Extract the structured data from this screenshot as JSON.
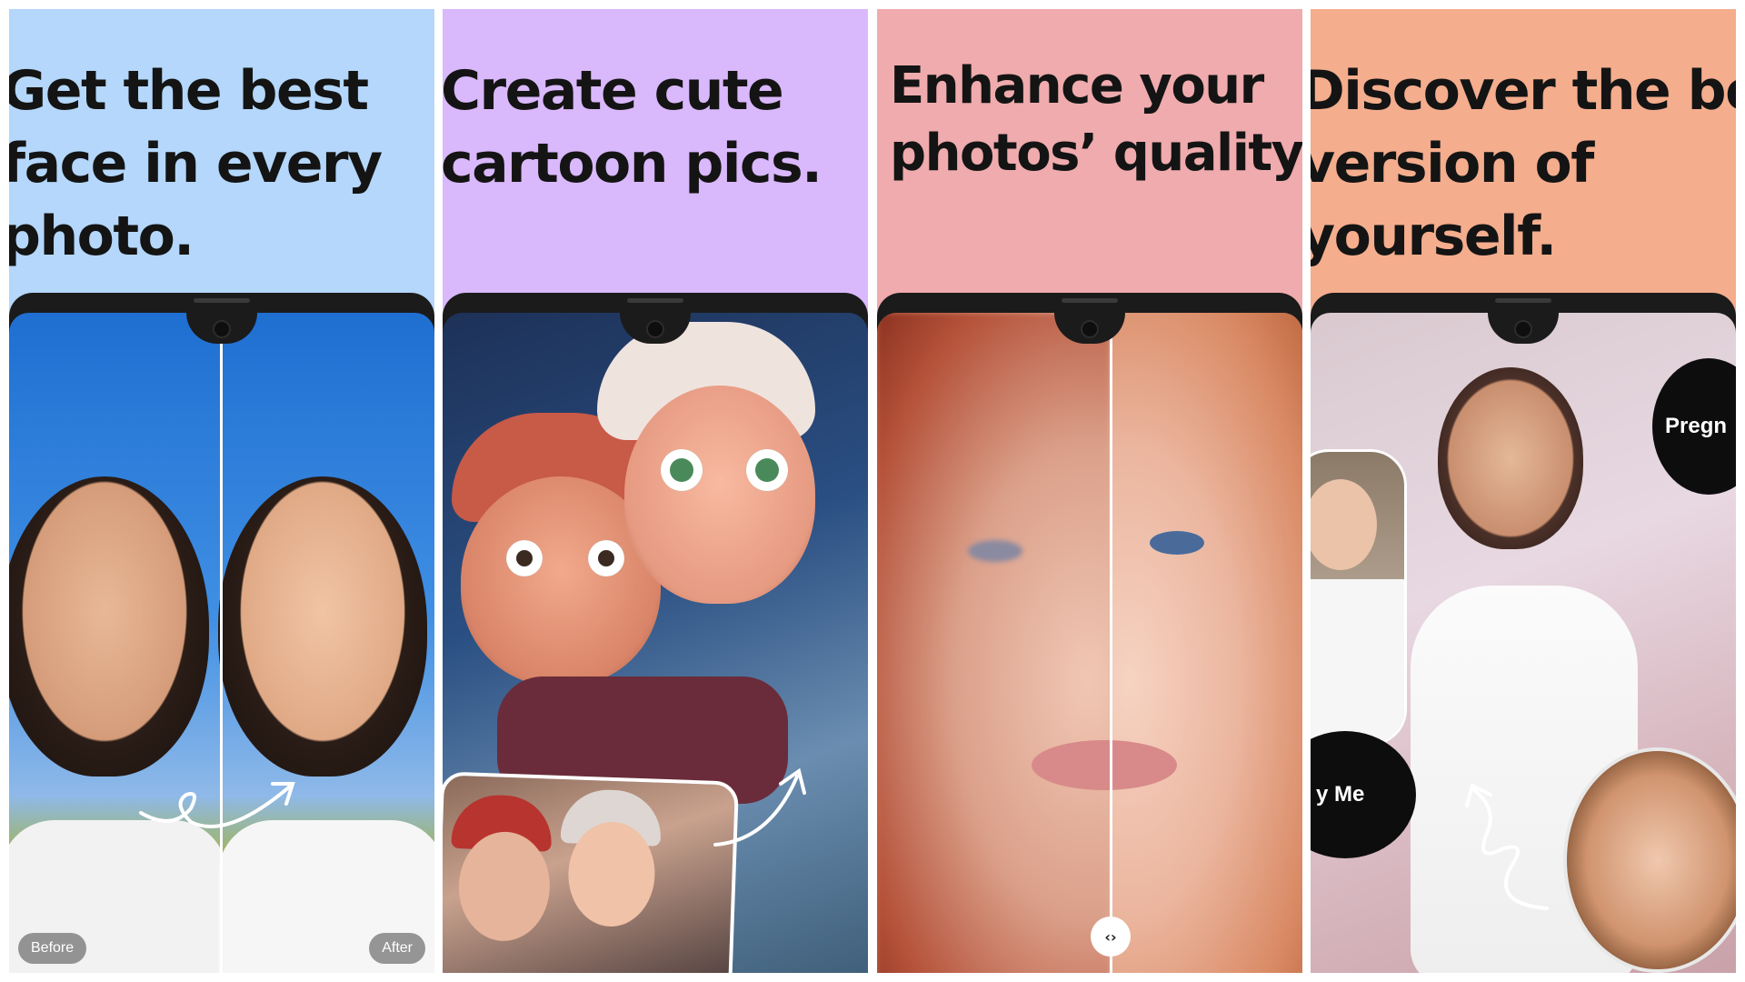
{
  "panels": [
    {
      "headline": [
        "Get the best",
        "face in every",
        "photo."
      ],
      "bg": "#b4d7fb",
      "before_label": "Before",
      "after_label": "After"
    },
    {
      "headline": [
        "Create cute",
        "cartoon pics."
      ],
      "bg": "#d9b8fb"
    },
    {
      "headline": [
        "Enhance your",
        "photos’ quality."
      ],
      "bg": "#efabad",
      "slider_icon": "‹›"
    },
    {
      "headline": [
        "Discover the best",
        "version of",
        "yourself."
      ],
      "bg": "#f4ad8d",
      "badge_pregnant": "Pregn",
      "badge_me": "y Me"
    }
  ],
  "colors": {
    "headline_text": "#141414",
    "phone_frame": "#1b1b1b",
    "divider": "#ffffff"
  },
  "icons": [
    "camera-notch-icon",
    "swirl-arrow-icon",
    "slider-handle-icon"
  ]
}
